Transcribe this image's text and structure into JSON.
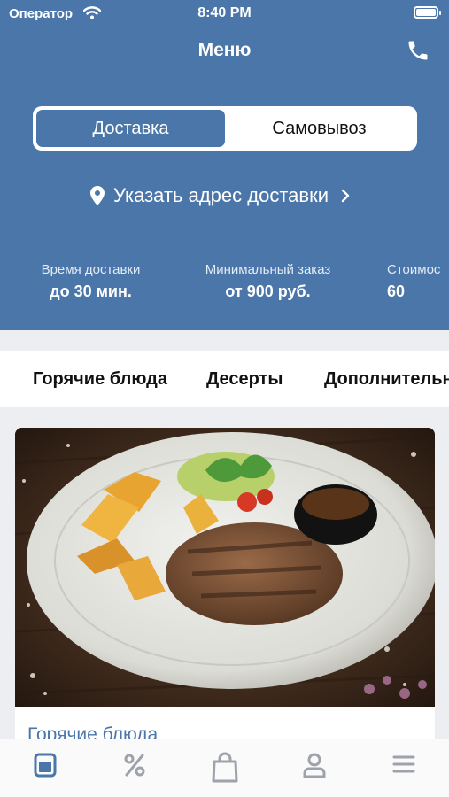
{
  "status_bar": {
    "carrier": "Оператор",
    "time": "8:40 PM",
    "battery_level": 1.0
  },
  "header": {
    "title": "Меню",
    "segments": [
      {
        "label": "Доставка",
        "active": true
      },
      {
        "label": "Самовывоз",
        "active": false
      }
    ],
    "address_label": "Указать адрес доставки",
    "info": [
      {
        "label": "Время доставки",
        "value": "до 30 мин."
      },
      {
        "label": "Минимальный заказ",
        "value": "от 900 руб."
      },
      {
        "label": "Стоимос",
        "value": "60"
      }
    ]
  },
  "categories": [
    "Горячие блюда",
    "Десерты",
    "Дополнительн"
  ],
  "card": {
    "title": "Горячие блюда"
  },
  "tabbar": {
    "items": [
      {
        "icon": "menu-icon",
        "active": true
      },
      {
        "icon": "percent-icon",
        "active": false
      },
      {
        "icon": "bag-icon",
        "active": false
      },
      {
        "icon": "profile-icon",
        "active": false
      },
      {
        "icon": "hamburger-icon",
        "active": false
      }
    ]
  },
  "colors": {
    "brand": "#4a76aa",
    "inactive_icon": "#9ea3ab",
    "background": "#eceef1"
  }
}
